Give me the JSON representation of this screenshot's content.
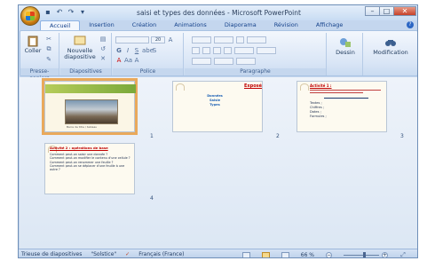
{
  "window": {
    "title": "saisi et types des données - Microsoft PowerPoint"
  },
  "qat": {
    "save_icon": "save-icon",
    "undo_icon": "undo-icon",
    "redo_icon": "redo-icon"
  },
  "tabs": [
    {
      "label": "Accueil",
      "active": true
    },
    {
      "label": "Insertion"
    },
    {
      "label": "Création"
    },
    {
      "label": "Animations"
    },
    {
      "label": "Diaporama"
    },
    {
      "label": "Révision"
    },
    {
      "label": "Affichage"
    }
  ],
  "ribbon": {
    "clipboard": {
      "paste_label": "Coller",
      "group_label": "Presse-papiers"
    },
    "slides": {
      "new_slide_label": "Nouvelle diapositive",
      "group_label": "Diapositives"
    },
    "font": {
      "size_value": "20",
      "group_label": "Police"
    },
    "paragraph": {
      "group_label": "Paragraphe"
    },
    "drawing": {
      "label": "Dessin"
    },
    "editing": {
      "label": "Modification"
    }
  },
  "slides": [
    {
      "number": "1",
      "caption": "Barre de titre / tableau"
    },
    {
      "number": "2",
      "title": "Exposé",
      "lines": [
        "Données",
        "Saisie",
        "Types"
      ]
    },
    {
      "number": "3",
      "title": "Activité 1 :",
      "lines": [
        "Textes ;",
        "Chiffres ;",
        "Dates ;",
        "Formules ;"
      ]
    },
    {
      "number": "4",
      "title": "Activité 2 : opérations de base",
      "lines": [
        "Comment peut-on saisir une donnée ?",
        "Comment peut-on modifier le contenu d'une cellule ?",
        "Comment peut-on renommer une feuille ?",
        "Comment peut-on se déplacer d'une feuille à une autre ?"
      ]
    }
  ],
  "status": {
    "view_label": "Trieuse de diapositives",
    "theme": "\"Solstice\"",
    "language": "Français (France)",
    "zoom": "66 %"
  },
  "colors": {
    "selection": "#e9a95b",
    "accent": "#15428b"
  }
}
